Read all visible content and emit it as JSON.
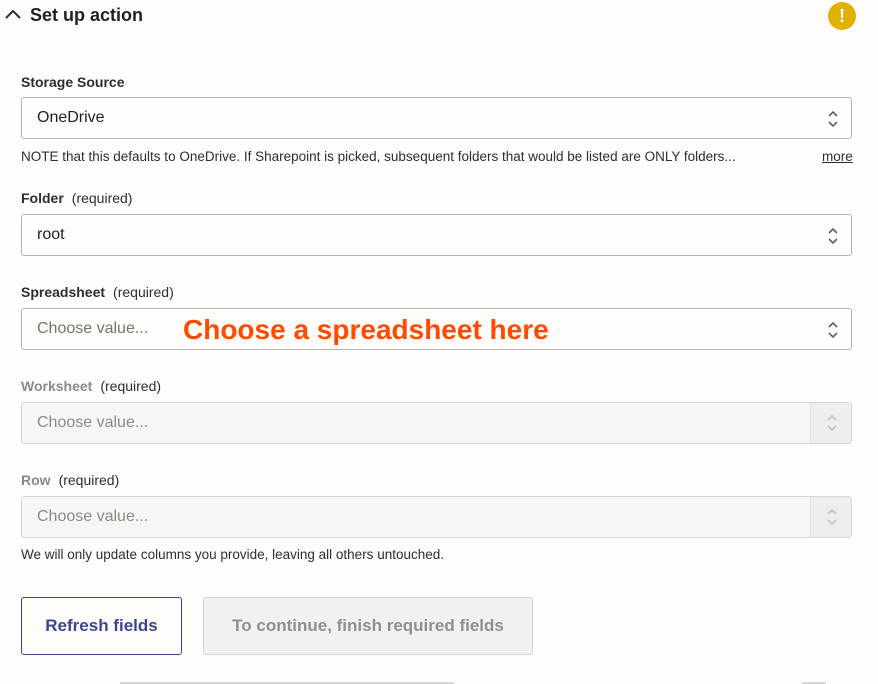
{
  "header": {
    "title": "Set up action",
    "warning_glyph": "!"
  },
  "fields": {
    "storage": {
      "label": "Storage Source",
      "value": "OneDrive",
      "note": "NOTE that this defaults to OneDrive. If Sharepoint is picked, subsequent folders that would be listed are ONLY folders...",
      "more": "more"
    },
    "folder": {
      "label": "Folder",
      "required": "(required)",
      "value": "root"
    },
    "spreadsheet": {
      "label": "Spreadsheet",
      "required": "(required)",
      "placeholder": "Choose value...",
      "annotation": "Choose a spreadsheet here"
    },
    "worksheet": {
      "label": "Worksheet",
      "required": "(required)",
      "placeholder": "Choose value..."
    },
    "row": {
      "label": "Row",
      "required": "(required)",
      "placeholder": "Choose value...",
      "note": "We will only update columns you provide, leaving all others untouched."
    }
  },
  "buttons": {
    "refresh": "Refresh fields",
    "continue": "To continue, finish required fields"
  },
  "colors": {
    "accent": "#3d4592",
    "annotation": "#ff4a00",
    "warning": "#e0b100",
    "background": "#fffdf9"
  },
  "icons": {
    "collapse": "chevron-up-icon",
    "warning": "warning-icon",
    "select": "up-down-arrows-icon"
  }
}
